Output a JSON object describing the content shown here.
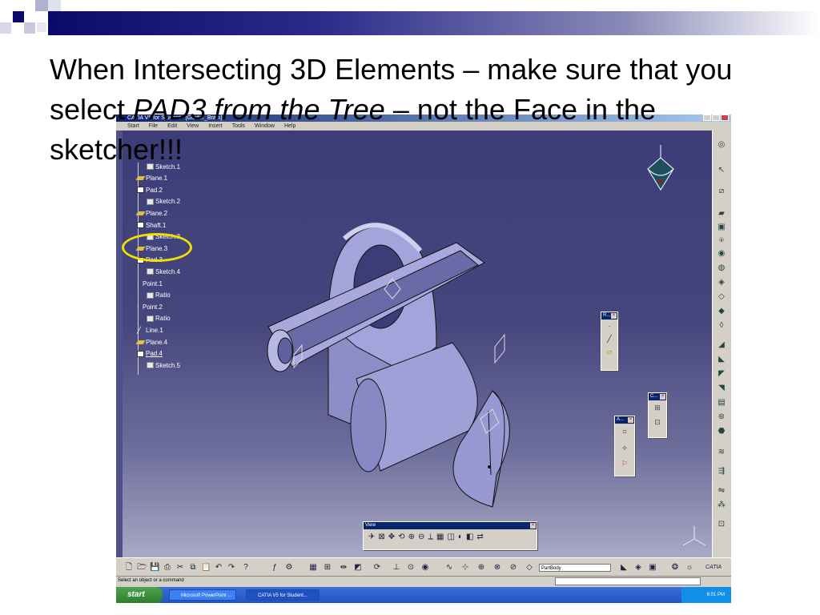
{
  "slide": {
    "title_part1": "When Intersecting 3D Elements – make sure that you select ",
    "title_italic": "PAD3 from the Tree",
    "title_part2": " – not the Face in the sketcher!!!"
  },
  "catia": {
    "window_title": "CATIA V5 for Student - [Gunter_Brain]",
    "menu": [
      "Start",
      "File",
      "Edit",
      "View",
      "Insert",
      "Tools",
      "Window",
      "Help"
    ],
    "tree": [
      {
        "label": "Sketch.1",
        "indent": 1,
        "icon": "sketch-icon"
      },
      {
        "label": "Plane.1",
        "indent": 0,
        "icon": "plane-icon"
      },
      {
        "label": "Pad.2",
        "indent": 0,
        "icon": "pad-icon"
      },
      {
        "label": "Sketch.2",
        "indent": 1,
        "icon": "sketch-icon"
      },
      {
        "label": "Plane.2",
        "indent": 0,
        "icon": "plane-icon"
      },
      {
        "label": "Shaft.1",
        "indent": 0,
        "icon": "shaft-icon"
      },
      {
        "label": "Sketch.3",
        "indent": 1,
        "icon": "sketch-icon"
      },
      {
        "label": "Plane.3",
        "indent": 0,
        "icon": "plane-icon"
      },
      {
        "label": "Pad.3",
        "indent": 0,
        "icon": "pad-icon"
      },
      {
        "label": "Sketch.4",
        "indent": 1,
        "icon": "sketch-icon"
      },
      {
        "label": "Point.1",
        "indent": 0,
        "icon": "point-icon"
      },
      {
        "label": "Ratio",
        "indent": 1,
        "icon": "formula-icon"
      },
      {
        "label": "Point.2",
        "indent": 0,
        "icon": "point-icon"
      },
      {
        "label": "Ratio",
        "indent": 1,
        "icon": "formula-icon"
      },
      {
        "label": "Line.1",
        "indent": 0,
        "icon": "line-icon"
      },
      {
        "label": "Plane.4",
        "indent": 0,
        "icon": "plane-icon"
      },
      {
        "label": "Pad.4",
        "indent": 0,
        "icon": "pad-icon"
      },
      {
        "label": "Sketch.5",
        "indent": 1,
        "icon": "sketch-icon"
      }
    ],
    "panels": {
      "r": "R...",
      "c": "C...",
      "a": "A...",
      "view": "View"
    },
    "partbody": "PartBody",
    "status": "Select an object or a command",
    "taskbar": {
      "start": "start",
      "tasks": [
        "Microsoft PowerPoint ...",
        "CATIA V5 for Student..."
      ],
      "time": "6:01 PM"
    },
    "brand": "CATIA"
  }
}
